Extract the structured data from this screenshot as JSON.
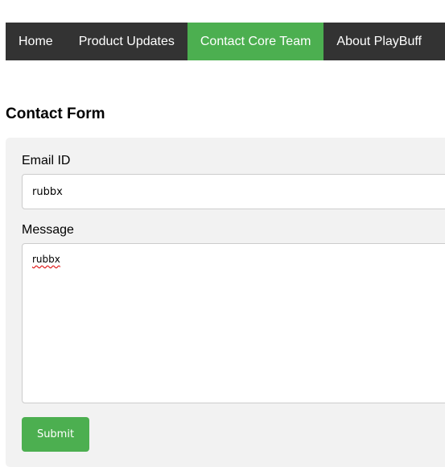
{
  "nav": {
    "items": [
      {
        "label": "Home"
      },
      {
        "label": "Product Updates"
      },
      {
        "label": "Contact Core Team"
      },
      {
        "label": "About PlayBuff"
      }
    ],
    "active_index": 2
  },
  "page": {
    "title": "Contact Form"
  },
  "form": {
    "email_label": "Email ID",
    "email_value": "rubbx",
    "message_label": "Message",
    "message_value": "rubbx",
    "submit_label": "Submit"
  },
  "colors": {
    "nav_bg": "#333333",
    "accent": "#4caf50",
    "panel_bg": "#f2f2f2"
  }
}
